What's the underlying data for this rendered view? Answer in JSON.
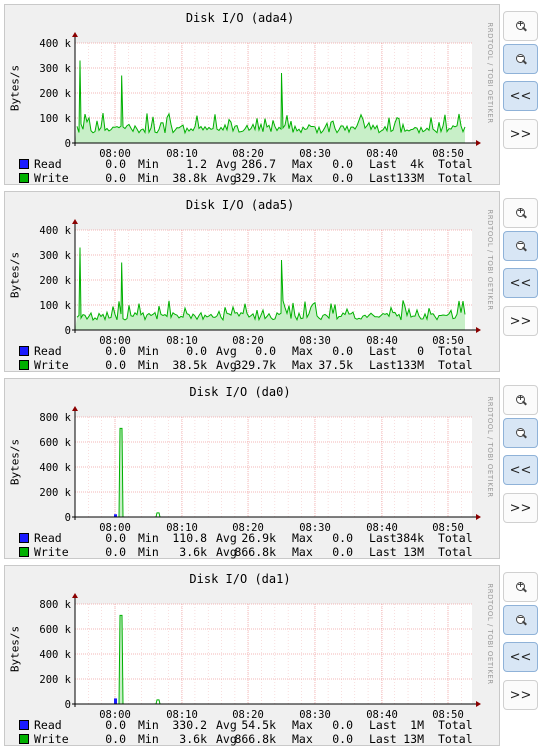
{
  "watermark": "RRDTOOL / TOBI OETIKER",
  "buttons": {
    "zoom_in": "+",
    "zoom_out": "−",
    "back": "<<",
    "forward": ">>"
  },
  "colors": {
    "read": "#1a1aff",
    "write": "#00b000",
    "write_fill": "#c8efc8",
    "grid": "#f0a0a0",
    "axis": "#8b0000"
  },
  "xticks": [
    "08:00",
    "08:10",
    "08:20",
    "08:30",
    "08:40",
    "08:50"
  ],
  "graphs": [
    {
      "title": "Disk I/O (ada4)",
      "ylabel": "Bytes/s",
      "yticks": [
        "400 k",
        "300 k",
        "200 k",
        "100 k",
        "0"
      ],
      "legend": [
        {
          "name": "Read",
          "vals": [
            "0.0",
            "Min",
            "1.2",
            "Avg",
            "286.7",
            "Max",
            "0.0",
            "Last",
            "4k",
            "Total"
          ]
        },
        {
          "name": "Write",
          "vals": [
            "0.0",
            "Min",
            "38.8k",
            "Avg",
            "329.7k",
            "Max",
            "0.0",
            "Last",
            "133M",
            "Total"
          ]
        }
      ]
    },
    {
      "title": "Disk I/O (ada5)",
      "ylabel": "Bytes/s",
      "yticks": [
        "400 k",
        "300 k",
        "200 k",
        "100 k",
        "0"
      ],
      "legend": [
        {
          "name": "Read",
          "vals": [
            "0.0",
            "Min",
            "0.0",
            "Avg",
            "0.0",
            "Max",
            "0.0",
            "Last",
            "0",
            "Total"
          ]
        },
        {
          "name": "Write",
          "vals": [
            "0.0",
            "Min",
            "38.5k",
            "Avg",
            "329.7k",
            "Max",
            "37.5k",
            "Last",
            "133M",
            "Total"
          ]
        }
      ]
    },
    {
      "title": "Disk I/O (da0)",
      "ylabel": "Bytes/s",
      "yticks": [
        "800 k",
        "600 k",
        "400 k",
        "200 k",
        "0"
      ],
      "legend": [
        {
          "name": "Read",
          "vals": [
            "0.0",
            "Min",
            "110.8",
            "Avg",
            "26.9k",
            "Max",
            "0.0",
            "Last",
            "384k",
            "Total"
          ]
        },
        {
          "name": "Write",
          "vals": [
            "0.0",
            "Min",
            "3.6k",
            "Avg",
            "866.8k",
            "Max",
            "0.0",
            "Last",
            "13M",
            "Total"
          ]
        }
      ]
    },
    {
      "title": "Disk I/O (da1)",
      "ylabel": "Bytes/s",
      "yticks": [
        "800 k",
        "600 k",
        "400 k",
        "200 k",
        "0"
      ],
      "legend": [
        {
          "name": "Read",
          "vals": [
            "0.0",
            "Min",
            "330.2",
            "Avg",
            "54.5k",
            "Max",
            "0.0",
            "Last",
            "1M",
            "Total"
          ]
        },
        {
          "name": "Write",
          "vals": [
            "0.0",
            "Min",
            "3.6k",
            "Avg",
            "866.8k",
            "Max",
            "0.0",
            "Last",
            "13M",
            "Total"
          ]
        }
      ]
    }
  ],
  "chart_data": [
    {
      "type": "area",
      "title": "Disk I/O (ada4)",
      "ylabel": "Bytes/s",
      "ylim": [
        0,
        400000
      ],
      "x_range": [
        "07:56",
        "08:53"
      ],
      "series": [
        {
          "name": "Read",
          "values": [
            0
          ]
        },
        {
          "name": "Write",
          "sparse_points": [
            {
              "x": "07:56",
              "y": 330000
            },
            {
              "x": "08:01",
              "y": 270000
            },
            {
              "x": "08:25",
              "y": 280000
            }
          ],
          "baseline_range": [
            40000,
            120000
          ]
        }
      ]
    },
    {
      "type": "area",
      "title": "Disk I/O (ada5)",
      "ylabel": "Bytes/s",
      "ylim": [
        0,
        400000
      ],
      "x_range": [
        "07:56",
        "08:53"
      ],
      "series": [
        {
          "name": "Read",
          "values": [
            0
          ]
        },
        {
          "name": "Write",
          "sparse_points": [
            {
              "x": "07:56",
              "y": 330000
            },
            {
              "x": "08:01",
              "y": 270000
            },
            {
              "x": "08:25",
              "y": 280000
            }
          ],
          "baseline_range": [
            40000,
            120000
          ]
        }
      ]
    },
    {
      "type": "area",
      "title": "Disk I/O (da0)",
      "ylabel": "Bytes/s",
      "ylim": [
        0,
        900000
      ],
      "x_range": [
        "07:56",
        "08:53"
      ],
      "series": [
        {
          "name": "Read",
          "sparse_points": [
            {
              "x": "07:59",
              "y": 26900
            }
          ]
        },
        {
          "name": "Write",
          "sparse_points": [
            {
              "x": "08:00",
              "y": 866800
            },
            {
              "x": "08:06",
              "y": 40000
            }
          ]
        }
      ]
    },
    {
      "type": "area",
      "title": "Disk I/O (da1)",
      "ylabel": "Bytes/s",
      "ylim": [
        0,
        900000
      ],
      "x_range": [
        "07:56",
        "08:53"
      ],
      "series": [
        {
          "name": "Read",
          "sparse_points": [
            {
              "x": "07:59",
              "y": 54500
            }
          ]
        },
        {
          "name": "Write",
          "sparse_points": [
            {
              "x": "08:00",
              "y": 866800
            },
            {
              "x": "08:06",
              "y": 40000
            }
          ]
        }
      ]
    }
  ]
}
